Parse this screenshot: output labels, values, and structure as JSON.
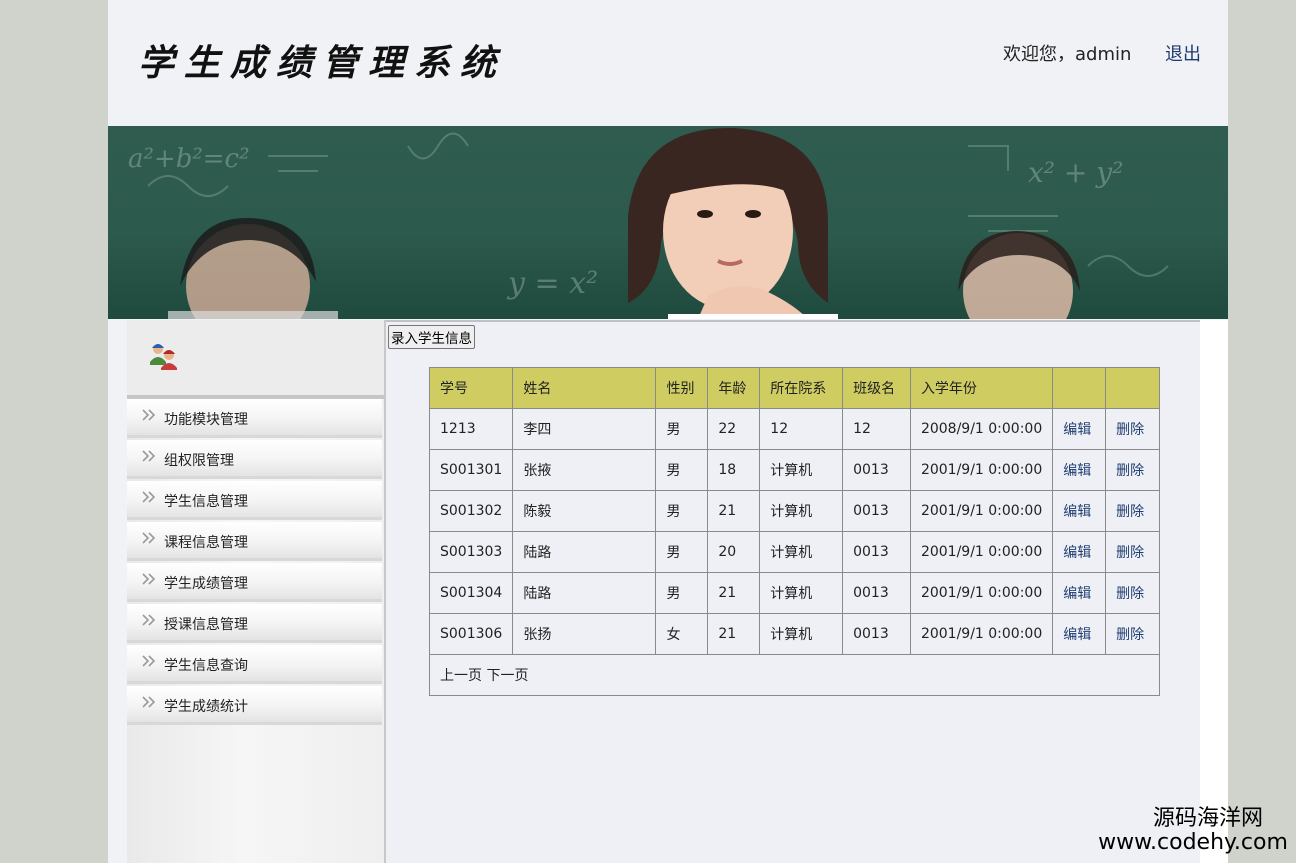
{
  "header": {
    "app_title": "学生成绩管理系统",
    "welcome_text": "欢迎您，admin",
    "logout_label": "退出"
  },
  "banner": {
    "chalk_1": "a²+b²=c²",
    "chalk_2": "y = x²",
    "chalk_3": "x² + y²"
  },
  "sidebar": {
    "items": [
      {
        "label": "功能模块管理"
      },
      {
        "label": "组权限管理"
      },
      {
        "label": "学生信息管理"
      },
      {
        "label": "课程信息管理"
      },
      {
        "label": "学生成绩管理"
      },
      {
        "label": "授课信息管理"
      },
      {
        "label": "学生信息查询"
      },
      {
        "label": "学生成绩统计"
      }
    ]
  },
  "toolbar": {
    "add_label": "录入学生信息"
  },
  "table": {
    "columns": [
      "学号",
      "姓名",
      "性别",
      "年龄",
      "所在院系",
      "班级名",
      "入学年份",
      "",
      ""
    ],
    "edit_label": "编辑",
    "delete_label": "删除",
    "rows": [
      {
        "id": "1213",
        "name": "李四",
        "gender": "男",
        "age": "22",
        "dept": "12",
        "class": "12",
        "enroll": "2008/9/1 0:00:00"
      },
      {
        "id": "S001301",
        "name": "张掖",
        "gender": "男",
        "age": "18",
        "dept": "计算机",
        "class": "0013",
        "enroll": "2001/9/1 0:00:00"
      },
      {
        "id": "S001302",
        "name": "陈毅",
        "gender": "男",
        "age": "21",
        "dept": "计算机",
        "class": "0013",
        "enroll": "2001/9/1 0:00:00"
      },
      {
        "id": "S001303",
        "name": "陆路",
        "gender": "男",
        "age": "20",
        "dept": "计算机",
        "class": "0013",
        "enroll": "2001/9/1 0:00:00"
      },
      {
        "id": "S001304",
        "name": "陆路",
        "gender": "男",
        "age": "21",
        "dept": "计算机",
        "class": "0013",
        "enroll": "2001/9/1 0:00:00"
      },
      {
        "id": "S001306",
        "name": "张扬",
        "gender": "女",
        "age": "21",
        "dept": "计算机",
        "class": "0013",
        "enroll": "2001/9/1 0:00:00"
      }
    ],
    "pager": {
      "prev_label": "上一页",
      "next_label": "下一页"
    }
  },
  "watermark": {
    "site_name": "源码海洋网",
    "url": "www.codehy.com"
  },
  "colors": {
    "table_header": "#cfcd62",
    "link": "#223f73",
    "banner_board": "#2f5c4f"
  }
}
